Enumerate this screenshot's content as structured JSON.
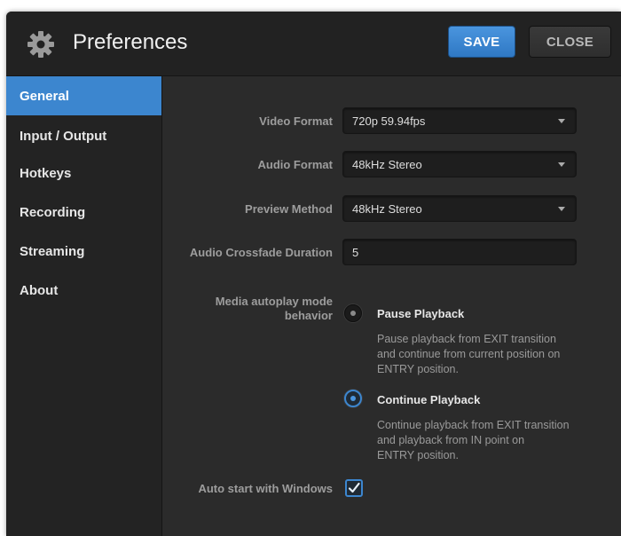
{
  "window": {
    "title": "Preferences"
  },
  "header": {
    "save_label": "SAVE",
    "close_label": "CLOSE"
  },
  "sidebar": {
    "items": [
      {
        "label": "General",
        "active": true
      },
      {
        "label": "Input / Output",
        "active": false
      },
      {
        "label": "Hotkeys",
        "active": false
      },
      {
        "label": "Recording",
        "active": false
      },
      {
        "label": "Streaming",
        "active": false
      },
      {
        "label": "About",
        "active": false
      }
    ]
  },
  "settings": {
    "video_format": {
      "label": "Video Format",
      "value": "720p 59.94fps"
    },
    "audio_format": {
      "label": "Audio Format",
      "value": "48kHz Stereo"
    },
    "preview_method": {
      "label": "Preview Method",
      "value": "48kHz Stereo"
    },
    "crossfade": {
      "label": "Audio Crossfade Duration",
      "value": "5"
    },
    "autoplay": {
      "label_line1": "Media autoplay mode",
      "label_line2": "behavior",
      "options": [
        {
          "title": "Pause Playback",
          "desc_line1": "Pause playback from EXIT transition",
          "desc_line2": "and continue from current position on",
          "desc_line3": "ENTRY position.",
          "selected": false
        },
        {
          "title": "Continue Playback",
          "desc_line1": "Continue playback from EXIT transition",
          "desc_line2": "and playback from IN point on",
          "desc_line3": "ENTRY position.",
          "selected": true
        }
      ]
    },
    "auto_start": {
      "label": "Auto start with Windows",
      "checked": true
    }
  },
  "icons": {
    "header": "gear-icon",
    "dropdown": "chevron-down-icon",
    "check": "checkmark-icon"
  },
  "colors": {
    "accent": "#3c86cf",
    "save_button": "#3a87d4",
    "background": "#2b2b2b",
    "sidebar": "#232323"
  }
}
